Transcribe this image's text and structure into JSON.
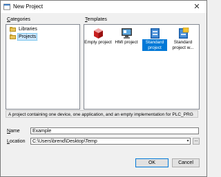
{
  "window": {
    "title": "New Project",
    "close_glyph": "✕"
  },
  "categories": {
    "label": "Categories",
    "label_access_key": "C",
    "items": [
      {
        "label": "Libraries",
        "icon": "folder-icon",
        "selected": false
      },
      {
        "label": "Projects",
        "icon": "folder-icon",
        "selected": true
      }
    ]
  },
  "templates": {
    "label": "Templates",
    "label_access_key": "T",
    "items": [
      {
        "label": "Empty project",
        "icon": "empty-project-icon",
        "selected": false
      },
      {
        "label": "HMI project",
        "icon": "hmi-project-icon",
        "selected": false
      },
      {
        "label": "Standard project",
        "icon": "standard-project-icon",
        "selected": true
      },
      {
        "label": "Standard project w...",
        "icon": "standard-project-with-app-icon",
        "selected": false
      }
    ]
  },
  "description": "A project containing one device, one application, and an empty implementation for PLC_PRG",
  "name_field": {
    "label": "Name",
    "access_key": "N",
    "value": "Example"
  },
  "location_field": {
    "label": "Location",
    "access_key": "L",
    "value": "C:\\Users\\brend\\Desktop\\Temp",
    "browse_label": "..."
  },
  "buttons": {
    "ok": "OK",
    "cancel": "Cancel"
  },
  "colors": {
    "accent": "#0078d7",
    "selection_highlight": "#cce8ff",
    "folder": "#e8c35a"
  }
}
